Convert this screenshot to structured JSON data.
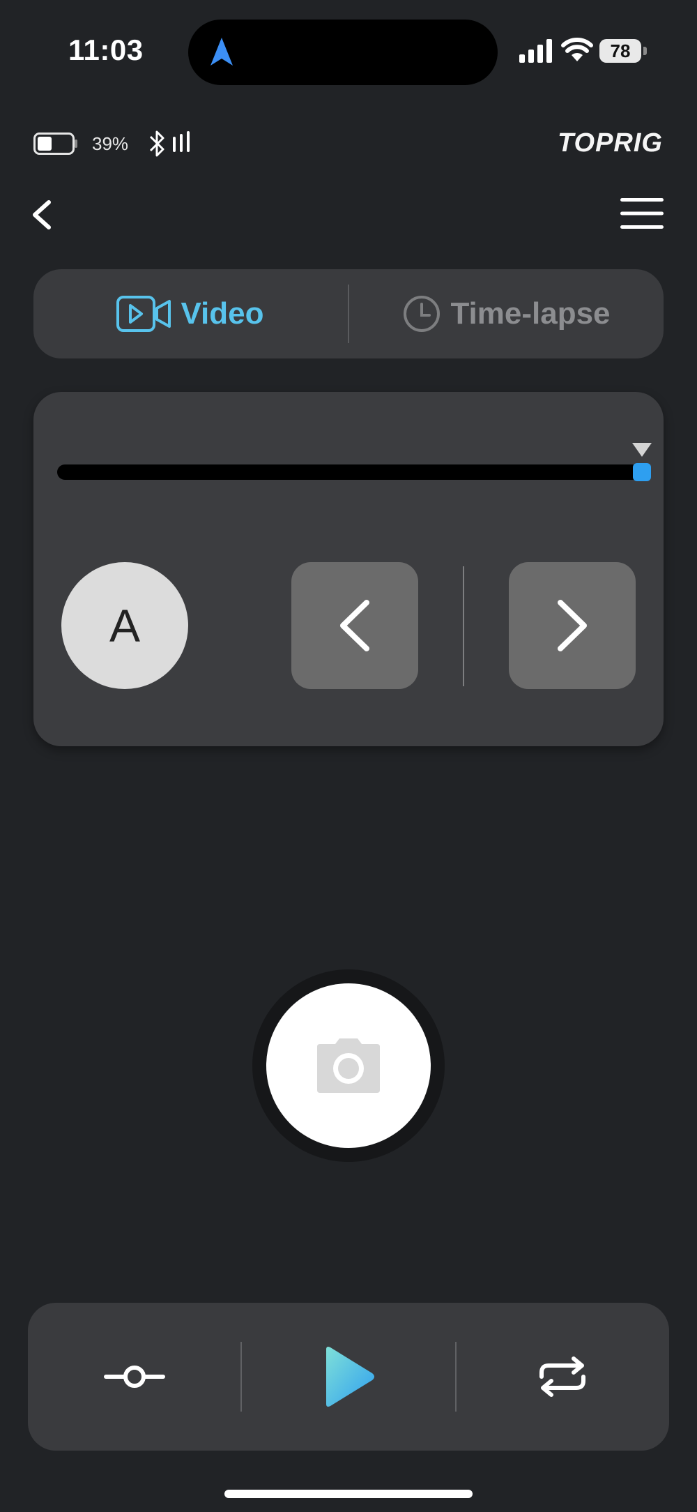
{
  "status_bar": {
    "time": "11:03",
    "phone_battery": "78"
  },
  "device": {
    "battery_percent": "39%",
    "brand": "TOPRIG"
  },
  "mode_tabs": {
    "video_label": "Video",
    "timelapse_label": "Time-lapse",
    "selected": "Video"
  },
  "control": {
    "slider_position": 1.0,
    "auto_label": "A"
  },
  "icons": {
    "navigation": "location-arrow-icon",
    "signal": "cellular-signal-icon",
    "wifi": "wifi-icon",
    "bluetooth": "bluetooth-icon",
    "back": "chevron-left-icon",
    "menu": "hamburger-menu-icon",
    "video": "video-camera-icon",
    "timelapse": "clock-icon",
    "shutter": "camera-icon",
    "keyframe": "keyframe-icon",
    "play": "play-icon",
    "loop": "repeat-icon"
  },
  "colors": {
    "accent": "#58c3ec",
    "background": "#212326",
    "card": "#3c3d40",
    "slider_thumb": "#2e9ff0"
  }
}
